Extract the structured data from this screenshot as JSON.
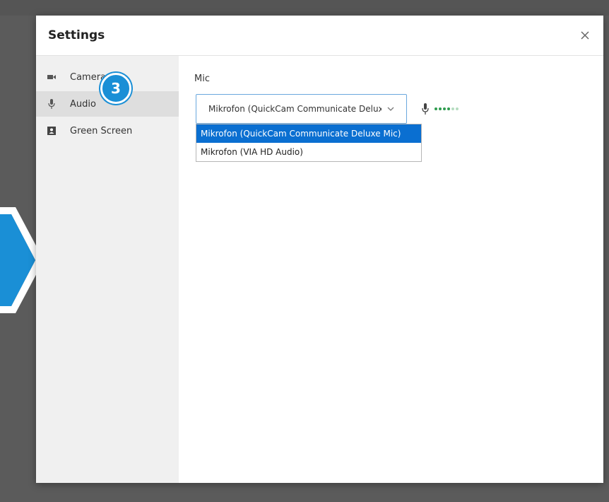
{
  "dialog": {
    "title": "Settings",
    "close_icon": "close-icon"
  },
  "sidebar": {
    "items": [
      {
        "label": "Camera",
        "icon": "camera-icon",
        "active": false
      },
      {
        "label": "Audio",
        "icon": "microphone-icon",
        "active": true
      },
      {
        "label": "Green Screen",
        "icon": "portrait-icon",
        "active": false
      }
    ]
  },
  "callout": {
    "step_number": "3",
    "color": "#1a8fd6"
  },
  "audio": {
    "mic_label": "Mic",
    "selected_value": "Mikrofon (QuickCam Communicate Deluxe Mic)",
    "options": [
      "Mikrofon (QuickCam Communicate Deluxe Mic)",
      "Mikrofon (VIA HD Audio)"
    ],
    "highlighted_option": 0,
    "level_color": "#2e9c4e"
  },
  "colors": {
    "accent": "#0a6fd1"
  }
}
